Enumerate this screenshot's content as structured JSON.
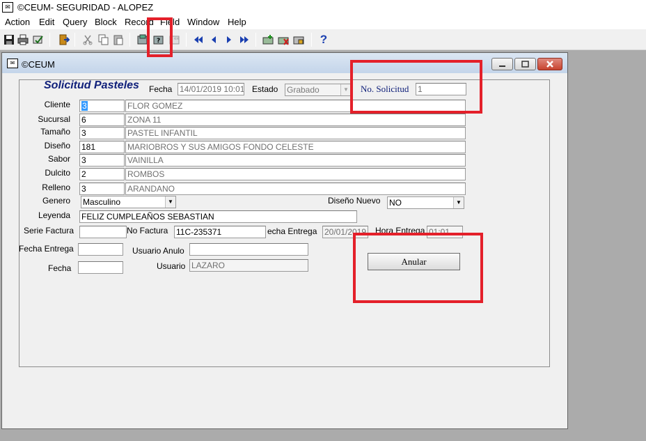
{
  "app": {
    "icon": "app-icon",
    "title": "©CEUM- SEGURIDAD - ALOPEZ"
  },
  "menu": [
    "Action",
    "Edit",
    "Query",
    "Block",
    "Record",
    "Field",
    "Window",
    "Help"
  ],
  "toolbar": {
    "icons": [
      "save-icon",
      "print-icon",
      "print-preview-icon",
      "exit-icon",
      "cut-icon",
      "copy-icon",
      "paste-icon",
      "enter-query-icon",
      "execute-query-icon",
      "cancel-query-icon",
      "first-record-icon",
      "previous-record-icon",
      "next-record-icon",
      "last-record-icon",
      "insert-record-icon",
      "delete-record-icon",
      "lock-record-icon",
      "help-icon"
    ],
    "help_label": "?"
  },
  "window": {
    "icon": "app-icon",
    "title": "©CEUM"
  },
  "form": {
    "title": "Solicitud Pasteles",
    "fecha_label": "Fecha",
    "fecha_value": "14/01/2019 10:01",
    "estado_label": "Estado",
    "estado_value": "Grabado",
    "no_solicitud_label": "No. Solicitud",
    "no_solicitud_value": "1",
    "rows": [
      {
        "label": "Cliente",
        "code": "3",
        "desc": "FLOR GOMEZ"
      },
      {
        "label": "Sucursal",
        "code": "6",
        "desc": "ZONA 11"
      },
      {
        "label": "Tamaño",
        "code": "3",
        "desc": "PASTEL INFANTIL"
      },
      {
        "label": "Diseño",
        "code": "181",
        "desc": "MARIOBROS Y SUS AMIGOS FONDO CELESTE"
      },
      {
        "label": "Sabor",
        "code": "3",
        "desc": "VAINILLA"
      },
      {
        "label": "Dulcito",
        "code": "2",
        "desc": "ROMBOS"
      },
      {
        "label": "Relleno",
        "code": "3",
        "desc": "ARANDANO"
      }
    ],
    "genero_label": "Genero",
    "genero_value": "Masculino",
    "diseno_nuevo_label": "Diseño Nuevo",
    "diseno_nuevo_value": "NO",
    "leyenda_label": "Leyenda",
    "leyenda_value": "FELIZ CUMPLEAÑOS SEBASTIAN",
    "serie_factura_label": "Serie Factura",
    "serie_factura_value": "",
    "no_factura_label": "No Factura",
    "no_factura_value": "11C-235371",
    "fecha_entrega_label": "echa Entrega",
    "fecha_entrega_value": "20/01/2019",
    "hora_entrega_label": "Hora Entrega",
    "hora_entrega_value": "01:01",
    "fecha_entrega2_label": "Fecha Entrega",
    "fecha_entrega2_value": "",
    "usuario_anulo_label": "Usuario Anulo",
    "usuario_anulo_value": "",
    "fecha2_label": "Fecha",
    "fecha2_value": "",
    "usuario_label": "Usuario",
    "usuario_value": "LAZARO",
    "anular_button": "Anular"
  },
  "colors": {
    "highlight": "#e4202a",
    "title_blue": "#10207a",
    "selection": "#3399ff"
  }
}
